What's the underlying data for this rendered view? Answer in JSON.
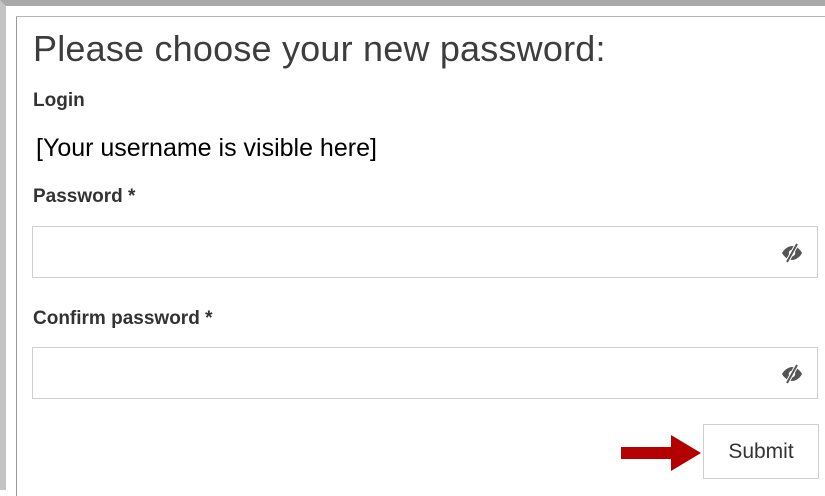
{
  "form": {
    "title": "Please choose your new password:",
    "login_label": "Login",
    "username_placeholder_text": "[Your username is visible here]",
    "password_label": "Password *",
    "password_value": "",
    "confirm_password_label": "Confirm password *",
    "confirm_password_value": "",
    "submit_label": "Submit"
  },
  "icons": {
    "password_visibility": "eye-slash-icon",
    "confirm_visibility": "eye-slash-icon",
    "pointer": "right-arrow-icon"
  },
  "colors": {
    "arrow": "#b30000",
    "border": "#cfcfcf",
    "text": "#333333"
  }
}
